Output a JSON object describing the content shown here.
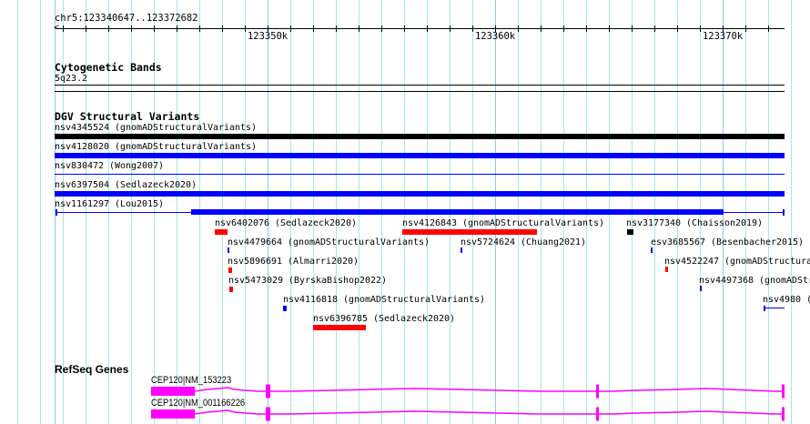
{
  "ruler": {
    "location": "chr5:123340647..123372682",
    "labels": [
      "123350k",
      "123360k",
      "123370k"
    ]
  },
  "tracks": {
    "cytoband": {
      "title": "Cytogenetic Bands",
      "band": "5q23.2"
    },
    "dgv": {
      "title": "DGV Structural Variants",
      "features": [
        {
          "label": "nsv4345524 (gnomADStructuralVariants)",
          "color": "#000000"
        },
        {
          "label": "nsv4128020 (gnomADStructuralVariants)",
          "color": "#0000ff"
        },
        {
          "label": "nsv830472 (Wong2007)",
          "color": "#0000ff"
        },
        {
          "label": "nsv6397504 (Sedlazeck2020)",
          "color": "#0000ff"
        },
        {
          "label": "nsv1161297 (Lou2015)",
          "color": "#0000ff"
        },
        {
          "label": "nsv6402076 (Sedlazeck2020)",
          "color": "#ff0000"
        },
        {
          "label": "nsv4126843 (gnomADStructuralVariants)",
          "color": "#ff0000"
        },
        {
          "label": "nsv3177340 (Chaisson2019)",
          "color": "#000000"
        },
        {
          "label": "nsv4479664 (gnomADStructuralVariants)",
          "color": "#0000ff"
        },
        {
          "label": "nsv5724624 (Chuang2021)",
          "color": "#0000ff"
        },
        {
          "label": "esv3685567 (Besenbacher2015)",
          "color": "#0000ff"
        },
        {
          "label": "nsv5896691 (Almarri2020)",
          "color": "#ff0000"
        },
        {
          "label": "nsv4522247 (gnomADStructura",
          "color": "#ff0000"
        },
        {
          "label": "nsv5473029 (ByrskaBishop2022)",
          "color": "#ff0000"
        },
        {
          "label": "nsv4497368 (gnomADStr",
          "color": "#0000ff"
        },
        {
          "label": "nsv4116818 (gnomADStructuralVariants)",
          "color": "#0000ff"
        },
        {
          "label": "nsv4980 (",
          "color": "#0000ff"
        },
        {
          "label": "nsv6396785 (Sedlazeck2020)",
          "color": "#ff0000"
        }
      ]
    },
    "refseq": {
      "title": "RefSeq Genes",
      "color": "#ff00ff",
      "genes": [
        {
          "label": "CEP120|NM_153223"
        },
        {
          "label": "CEP120|NM_001166226"
        }
      ]
    }
  }
}
